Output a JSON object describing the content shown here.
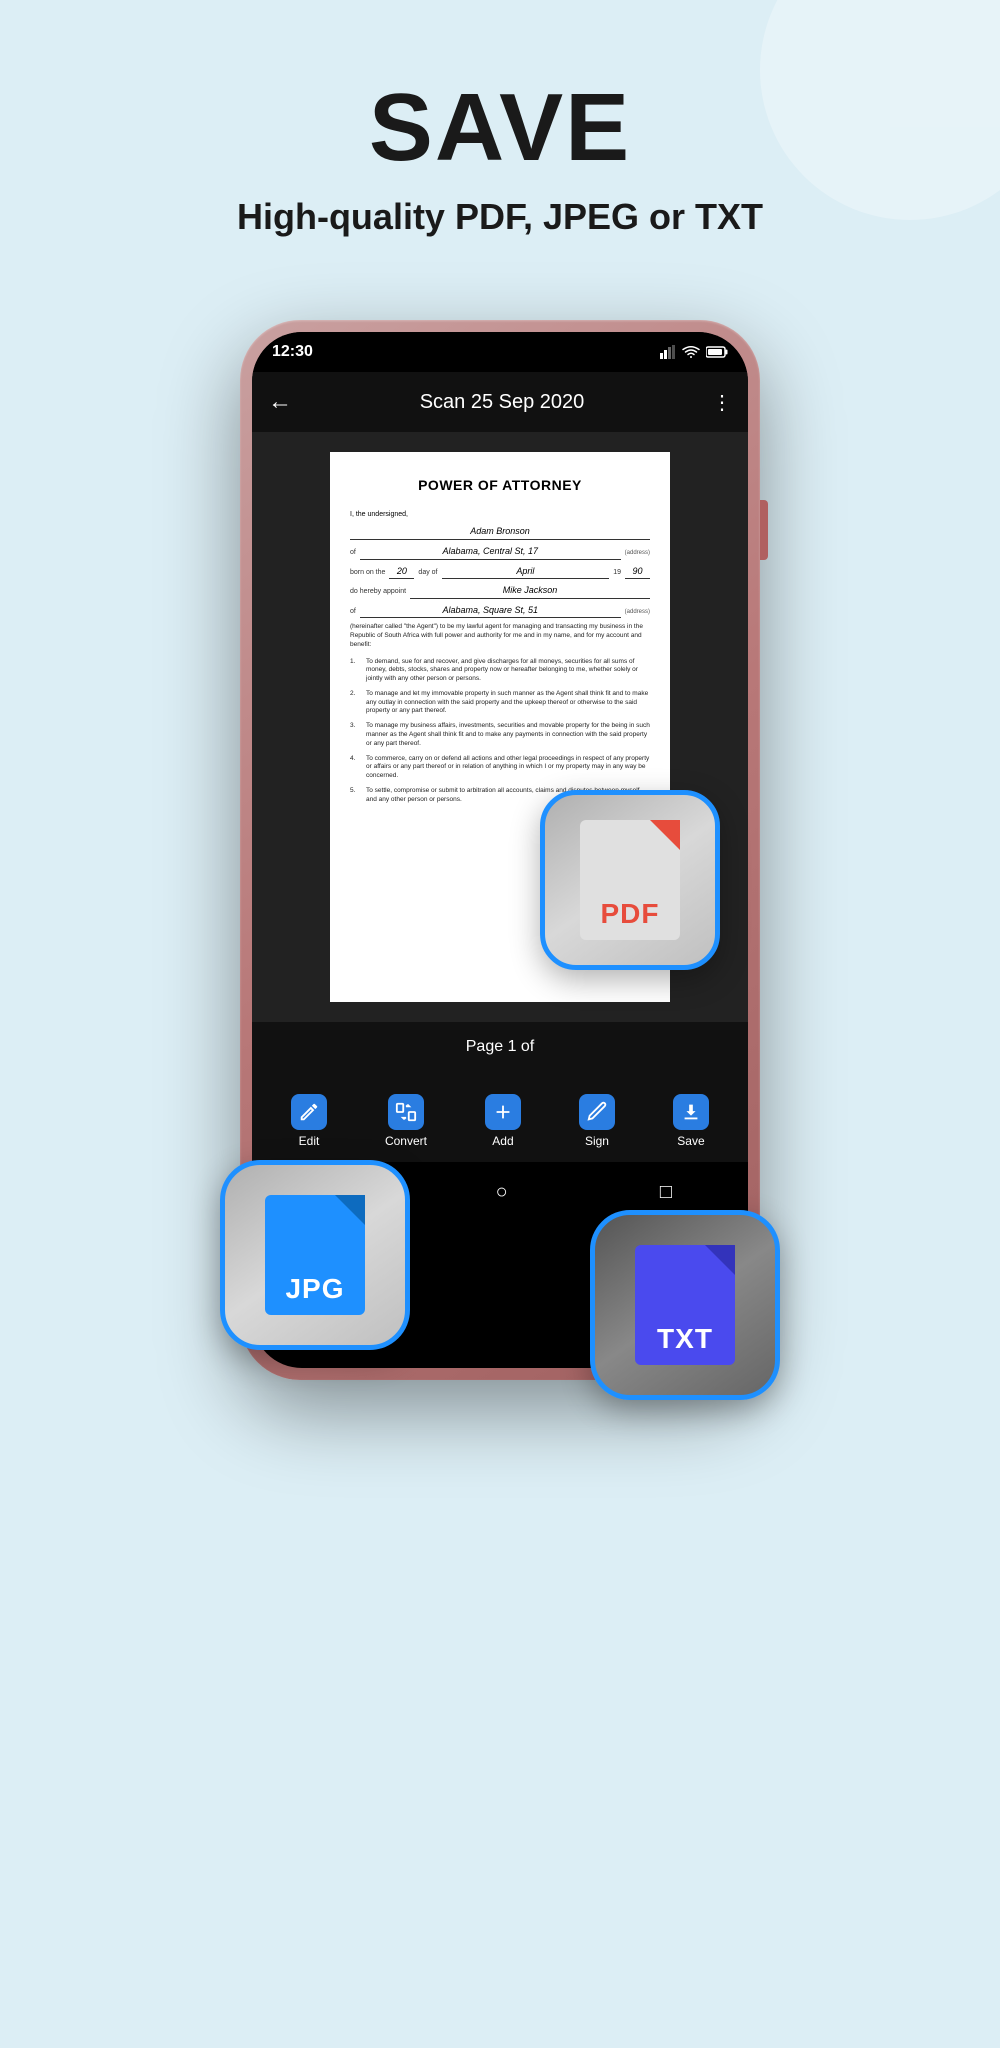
{
  "hero": {
    "title": "SAVE",
    "subtitle": "High-quality PDF, JPEG or TXT"
  },
  "phone": {
    "status_time": "12:30",
    "app_title": "Scan 25 Sep 2020",
    "page_indicator": "Page 1 of",
    "back_icon": "←",
    "menu_icon": "⋮"
  },
  "document": {
    "title": "POWER OF ATTORNEY",
    "intro": "I, the undersigned,",
    "name_label": "Adam Bronson",
    "address_label": "of",
    "address_value": "Alabama, Central St, 17",
    "address_tag": "(address)",
    "born_label": "born on the",
    "born_day": "20",
    "born_day_label": "day of",
    "born_month": "April",
    "born_year": "19",
    "born_year_val": "90",
    "appoint_label": "do hereby appoint",
    "appoint_name": "Mike Jackson",
    "appoint_of": "of",
    "appoint_address": "Alabama, Square St, 51",
    "appoint_address_tag": "(address)",
    "paragraph": "(hereinafter called \"the Agent\") to be my lawful agent for managing and transacting my business in the Republic of South Africa with full power and authority for me and in my name, and for my account and benefit:",
    "items": [
      "To demand, sue for and recover, and give discharges for all moneys, securities for all sums of money, debts, stocks, shares and property now or hereafter belonging to me, whether solely or jointly with any other person or persons.",
      "To manage and let my immovable property in such manner as the Agent shall think fit and to make any outlay in connection with the said property and the upkeep thereof or otherwise to the said property or any part thereof.",
      "To manage my business affairs, investments, securities and movable property for the being in such manner as the Agent shall think fit and to make any payments in connection with the said property or any part thereof.",
      "To commerce, carry on or defend all actions and other legal proceedings in respect of any property or affairs or any part thereof or in relation of anything in which I or my property may in any way be concerned.",
      "To settle, compromise or submit to arbitration all accounts, claims and disputes between myself and any other person or persons."
    ]
  },
  "toolbar": {
    "edit_label": "Edit",
    "convert_label": "Convert",
    "add_label": "Add",
    "sign_label": "Sign",
    "save_label": "Save"
  },
  "format_icons": {
    "pdf_label": "PDF",
    "jpg_label": "JPG",
    "txt_label": "TXT"
  },
  "nav": {
    "back": "◁",
    "home": "○",
    "square": "□"
  }
}
